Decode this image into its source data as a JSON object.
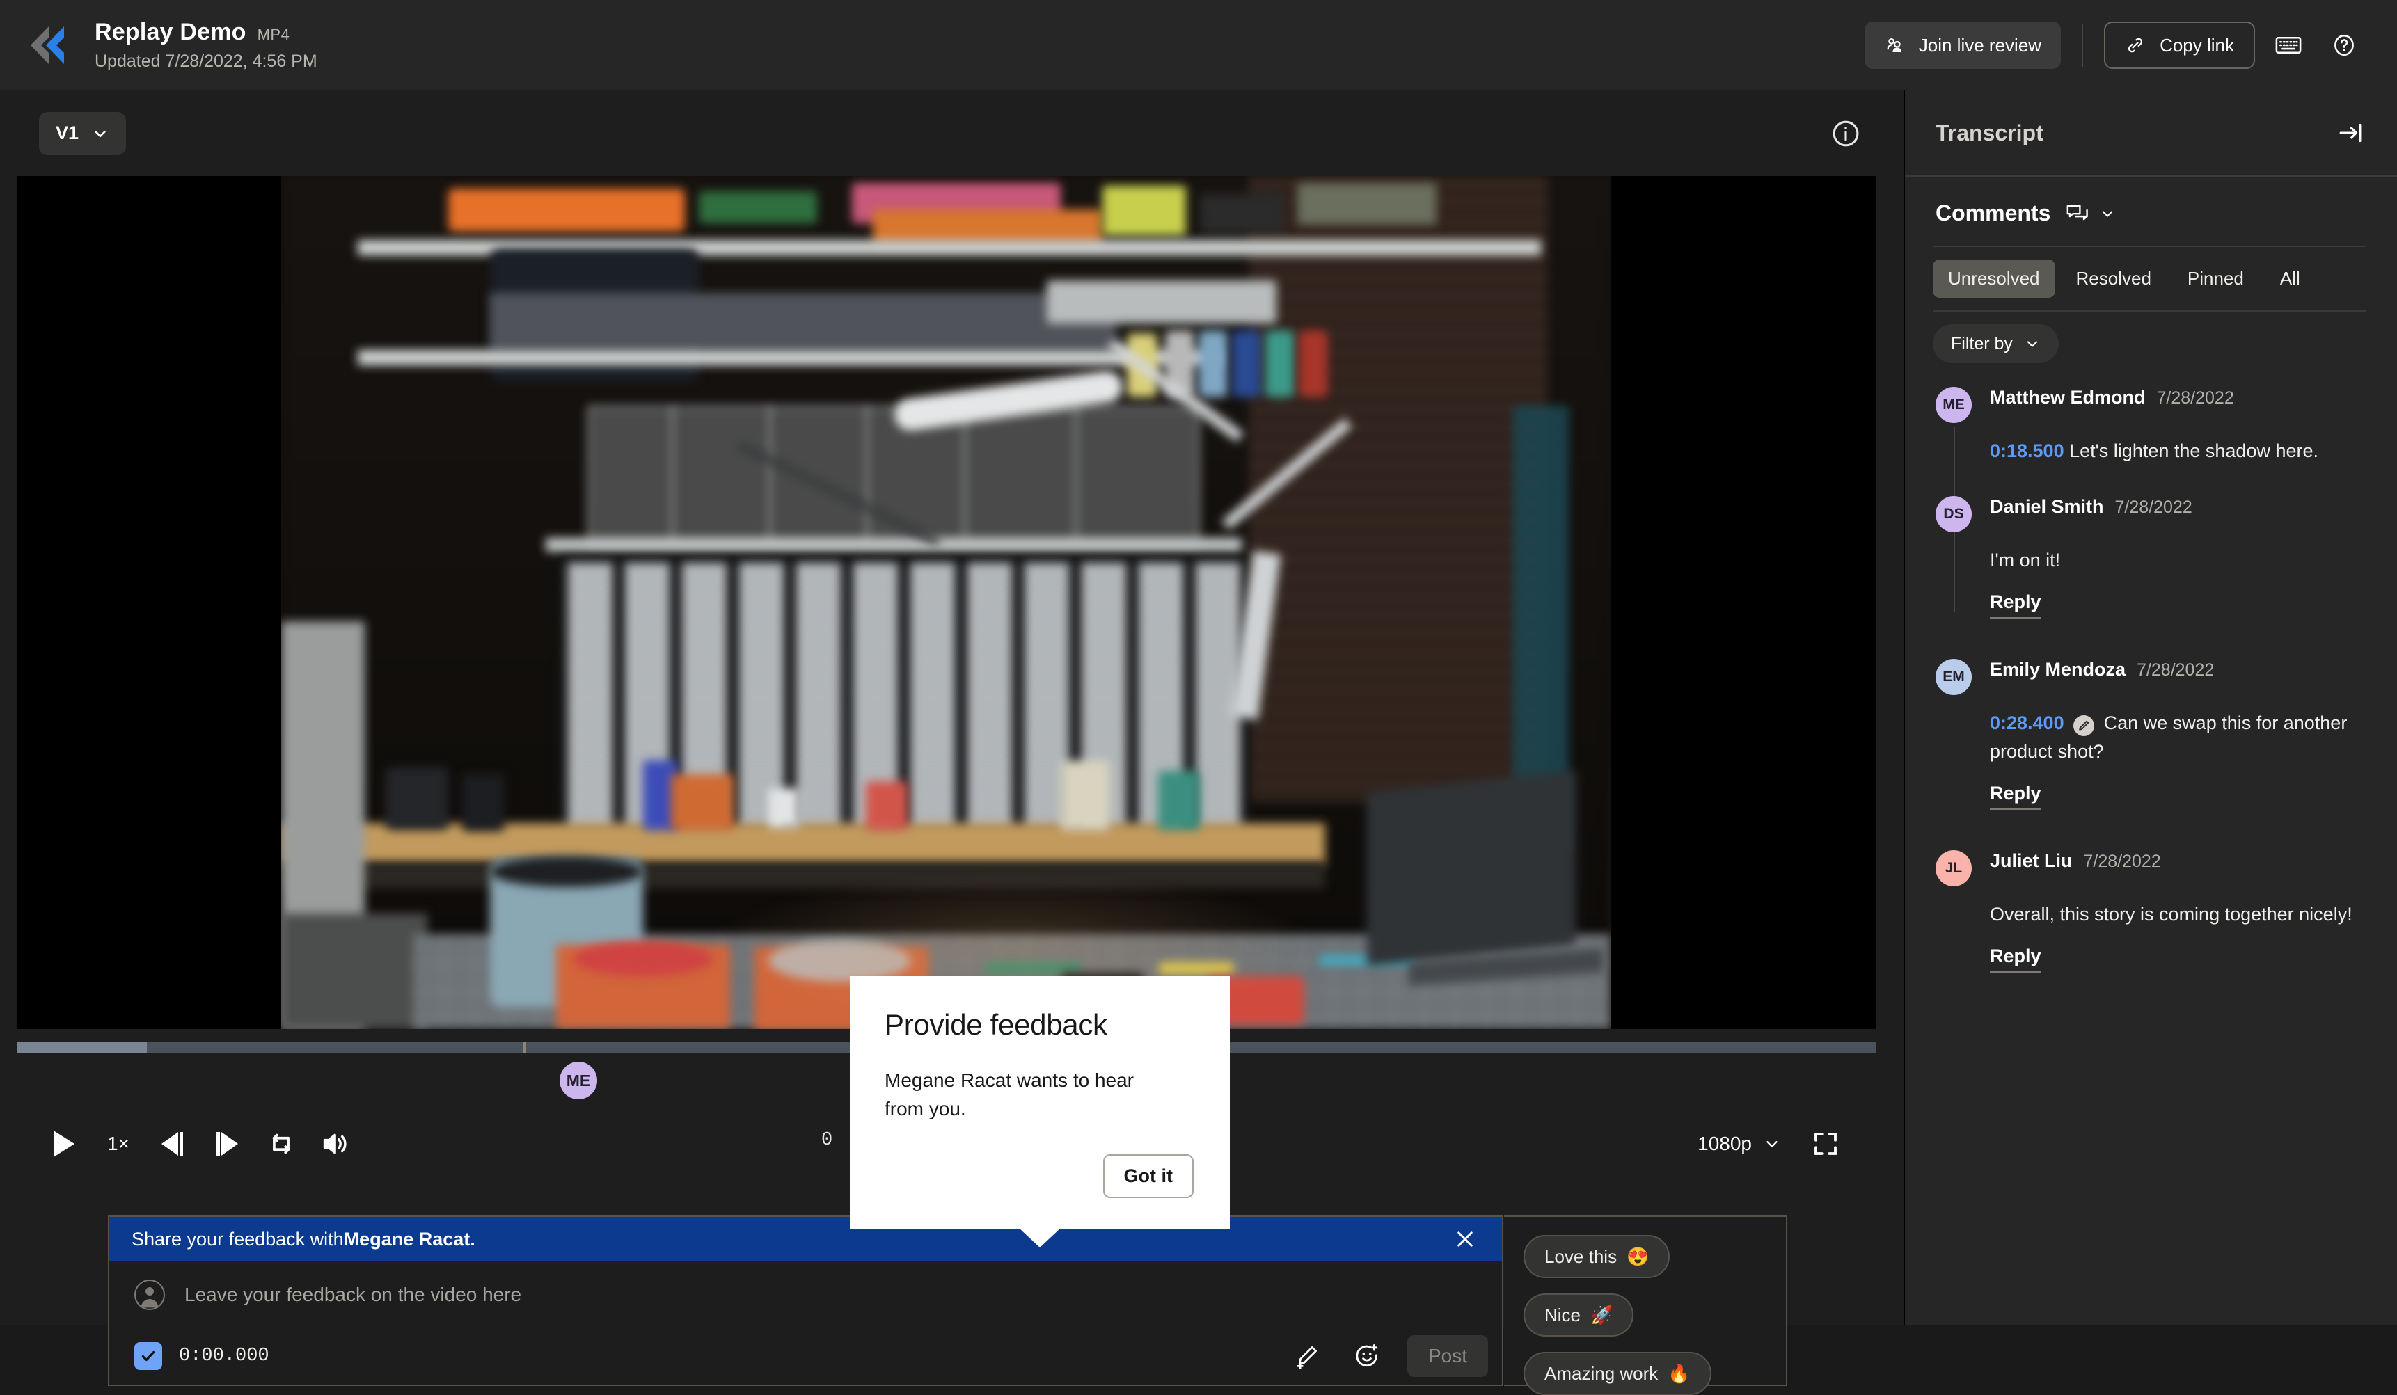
{
  "colors": {
    "accent_blue": "#5b9bf5",
    "banner_blue": "#0b3a8f",
    "topbar_bg": "#262626",
    "stage_bg": "#1e1e1e",
    "sidebar_bg": "#262626",
    "scrub_track": "#4a525c",
    "scrub_buffer": "#7a8594"
  },
  "topbar": {
    "logo_name": "frameio-logo",
    "title": "Replay Demo",
    "file_type": "MP4",
    "updated": "Updated 7/28/2022, 4:56 PM",
    "join_live_review_label": "Join live review",
    "copy_link_label": "Copy link",
    "keyboard_shortcuts_icon": "keyboard-icon",
    "help_icon": "help-icon"
  },
  "player": {
    "version_label": "V1",
    "info_icon": "info-icon",
    "play_label": "play",
    "speed_label": "1×",
    "prev_frame_label": "previous-frame",
    "next_frame_label": "next-frame",
    "loop_label": "loop",
    "volume_label": "volume",
    "current_time": "0",
    "quality": "1080p",
    "fullscreen_label": "fullscreen",
    "marker_initials": "ME",
    "buffer_percent": 7,
    "playhead_percent": 27.2
  },
  "composer": {
    "banner_prefix": "Share your feedback with ",
    "banner_name": "Megane Racat.",
    "close_icon": "close-icon",
    "avatar_icon": "user-avatar-icon",
    "placeholder": "Leave your feedback on the video here",
    "timestamp_checked": true,
    "timestamp_value": "0:00.000",
    "annotate_icon": "pencil-icon",
    "emoji_icon": "emoji-add-icon",
    "post_label": "Post"
  },
  "reactions": [
    {
      "label": "Love this",
      "emoji": "😍"
    },
    {
      "label": "Nice",
      "emoji": "🚀"
    },
    {
      "label": "Amazing work",
      "emoji": "🔥"
    }
  ],
  "tooltip": {
    "title": "Provide feedback",
    "body": "Megane Racat wants to hear from you.",
    "button_label": "Got it"
  },
  "sidebar": {
    "transcript_title": "Transcript",
    "collapse_icon": "collapse-panel-icon",
    "comments_title": "Comments",
    "comments_mode_icon": "comment-threads-icon",
    "comments_mode_chevron": "chevron-down-icon",
    "filter_tabs": [
      {
        "label": "Unresolved",
        "active": true
      },
      {
        "label": "Resolved",
        "active": false
      },
      {
        "label": "Pinned",
        "active": false
      },
      {
        "label": "All",
        "active": false
      }
    ],
    "filter_by_label": "Filter by",
    "threads": [
      {
        "comments": [
          {
            "initials": "ME",
            "avatar_color": "#cdb6ee",
            "author": "Matthew Edmond",
            "date": "7/28/2022",
            "timestamp": "0:18.500",
            "has_annotation": false,
            "text": "Let's lighten the shadow here.",
            "reply_label": null
          },
          {
            "initials": "DS",
            "avatar_color": "#cdb6ee",
            "author": "Daniel Smith",
            "date": "7/28/2022",
            "timestamp": null,
            "has_annotation": false,
            "text": "I'm on it!",
            "reply_label": "Reply"
          }
        ]
      },
      {
        "comments": [
          {
            "initials": "EM",
            "avatar_color": "#b9cdea",
            "author": "Emily Mendoza",
            "date": "7/28/2022",
            "timestamp": "0:28.400",
            "has_annotation": true,
            "text": "Can we swap this for another product shot?",
            "reply_label": "Reply"
          }
        ]
      },
      {
        "comments": [
          {
            "initials": "JL",
            "avatar_color": "#f9b3ab",
            "author": "Juliet Liu",
            "date": "7/28/2022",
            "timestamp": null,
            "has_annotation": false,
            "text": "Overall, this story is coming together nicely!",
            "reply_label": "Reply"
          }
        ]
      }
    ]
  }
}
